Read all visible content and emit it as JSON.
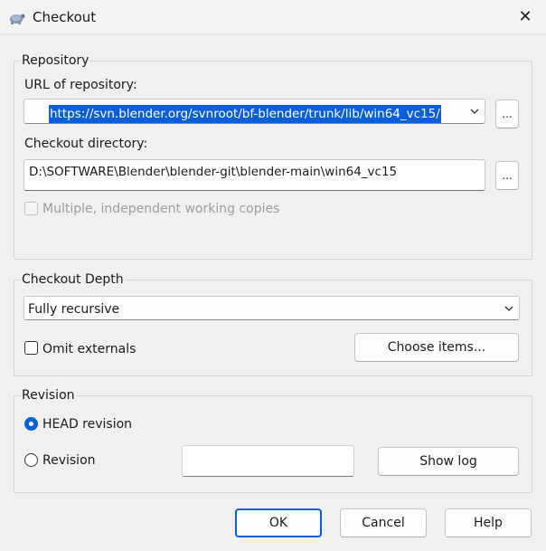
{
  "window": {
    "title": "Checkout",
    "close_glyph": "✕",
    "icon": "tortoise-svn-icon"
  },
  "repository": {
    "group_label": "Repository",
    "url_label": "URL of repository:",
    "url_value": "https://svn.blender.org/svnroot/bf-blender/trunk/lib/win64_vc15/",
    "url_browse_label": "...",
    "dir_label": "Checkout directory:",
    "dir_value": "D:\\SOFTWARE\\Blender\\blender-git\\blender-main\\win64_vc15",
    "dir_browse_label": "...",
    "multiple_label": "Multiple, independent working copies",
    "multiple_checked": false,
    "multiple_enabled": false
  },
  "depth": {
    "group_label": "Checkout Depth",
    "selected": "Fully recursive",
    "omit_label": "Omit externals",
    "omit_checked": false,
    "choose_label": "Choose items..."
  },
  "revision": {
    "group_label": "Revision",
    "head_label": "HEAD revision",
    "head_selected": true,
    "rev_label": "Revision",
    "rev_value": "",
    "show_log_label": "Show log"
  },
  "buttons": {
    "ok": "OK",
    "cancel": "Cancel",
    "help": "Help"
  },
  "colors": {
    "accent": "#0a5fd6",
    "background": "#f0f0f0"
  }
}
